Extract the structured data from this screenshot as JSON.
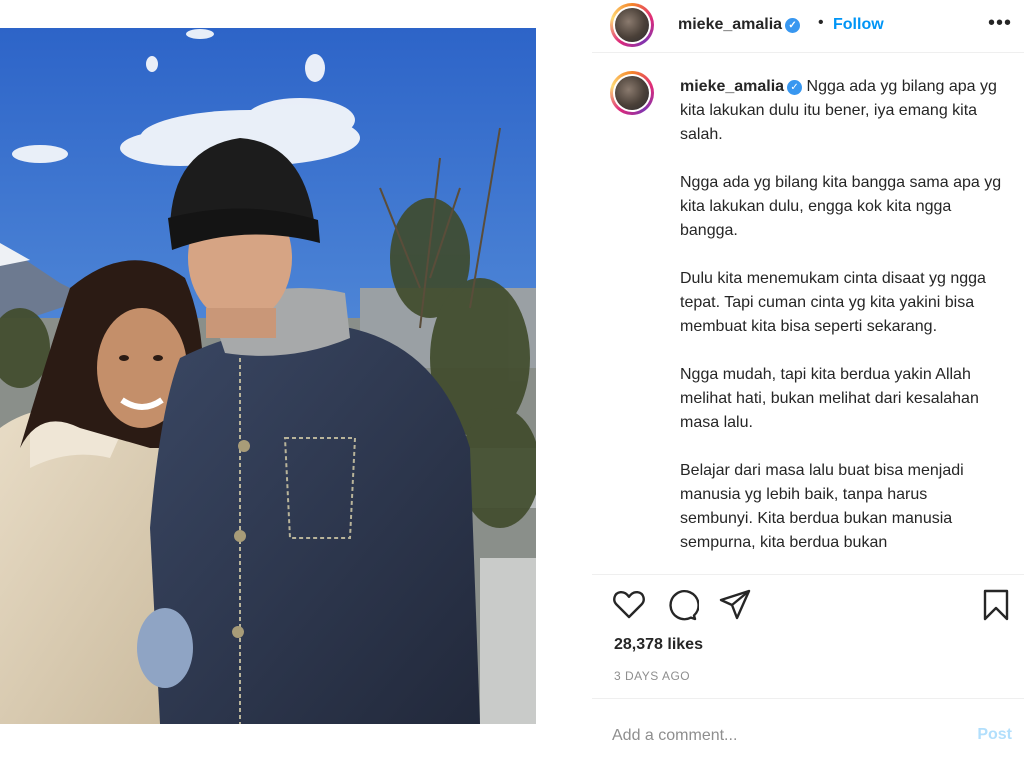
{
  "post": {
    "username": "mieke_amalia",
    "verified": true,
    "separator": "•",
    "follow_label": "Follow",
    "more_icon": "more-horizontal-icon",
    "photo_alt": "photo",
    "caption_paragraphs": [
      "Ngga ada yg bilang apa yg kita lakukan dulu itu bener, iya emang kita salah.",
      "Ngga ada yg bilang kita bangga sama apa yg kita lakukan dulu, engga kok kita ngga bangga.",
      "Dulu kita menemukam cinta disaat yg ngga tepat. Tapi cuman cinta yg kita yakini bisa membuat kita bisa seperti sekarang.",
      "Ngga mudah, tapi kita berdua yakin Allah melihat hati, bukan melihat dari kesalahan masa lalu.",
      "Belajar dari masa lalu buat bisa menjadi manusia yg lebih baik, tanpa harus sembunyi. Kita berdua bukan manusia sempurna, kita berdua bukan"
    ],
    "likes": "28,378 likes",
    "time_ago": "3 DAYS AGO",
    "comment_placeholder": "Add a comment...",
    "post_label": "Post"
  },
  "icons": {
    "like": "heart-icon",
    "comment": "comment-icon",
    "share": "send-icon",
    "save": "bookmark-icon"
  },
  "colors": {
    "link_blue": "#0095f6",
    "post_disabled": "#b2dffc",
    "text": "#262626",
    "muted": "#8e8e8e"
  }
}
